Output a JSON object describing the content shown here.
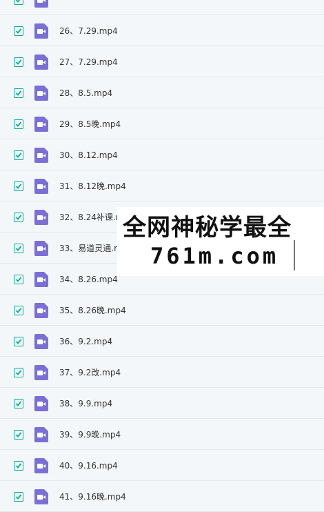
{
  "files": [
    {
      "name": ""
    },
    {
      "name": "26、7.29.mp4"
    },
    {
      "name": "27、7.29.mp4"
    },
    {
      "name": "28、8.5.mp4"
    },
    {
      "name": "29、8.5晚.mp4"
    },
    {
      "name": "30、8.12.mp4"
    },
    {
      "name": "31、8.12晚.mp4"
    },
    {
      "name": "32、8.24补课.mp4"
    },
    {
      "name": "33、易道灵通.mp4"
    },
    {
      "name": "34、8.26.mp4"
    },
    {
      "name": "35、8.26晚.mp4"
    },
    {
      "name": "36、9.2.mp4"
    },
    {
      "name": "37、9.2改.mp4"
    },
    {
      "name": "38、9.9.mp4"
    },
    {
      "name": "39、9.9晚.mp4"
    },
    {
      "name": "40、9.16.mp4"
    },
    {
      "name": "41、9.16晚.mp4"
    }
  ],
  "watermark": {
    "line1": "全网神秘学最全",
    "line2": "761m.com"
  },
  "colors": {
    "check": "#1aa595",
    "video_icon": "#7b6fd6"
  }
}
